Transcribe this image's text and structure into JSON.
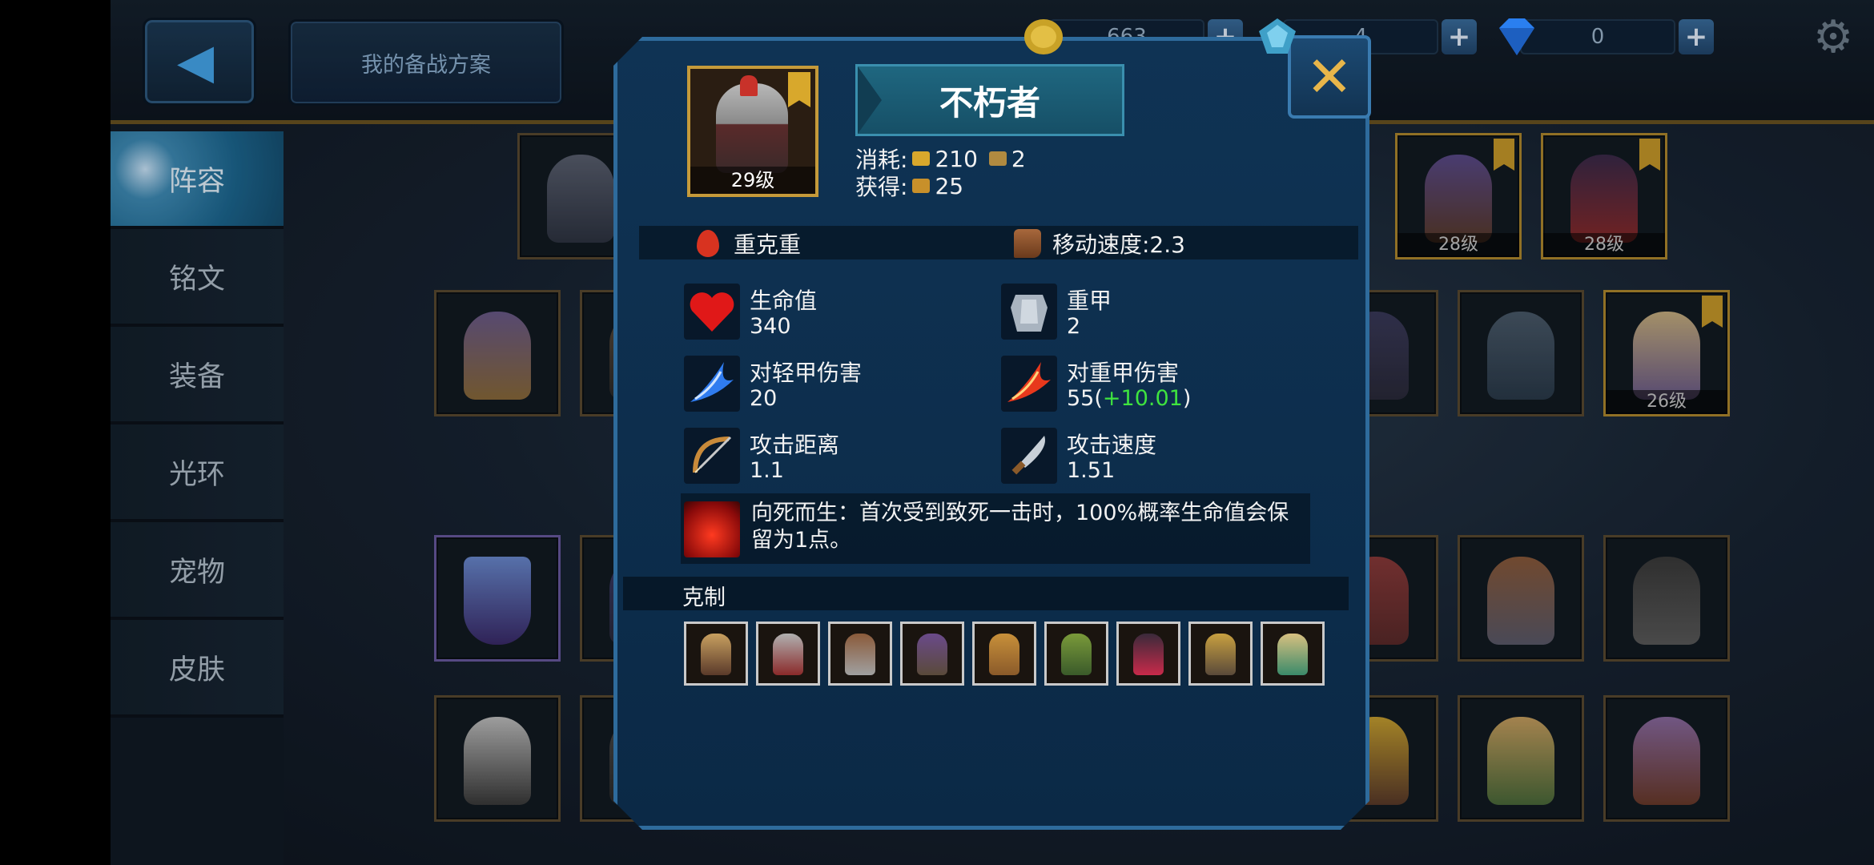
{
  "topbar": {
    "back_label": "‹",
    "plan_button": "我的备战方案",
    "currencies": [
      {
        "icon": "gold-coin-icon",
        "value": "663",
        "color": "#c9a227"
      },
      {
        "icon": "blue-gem-icon",
        "value": "4",
        "color": "#3fa0c8"
      },
      {
        "icon": "diamond-icon",
        "value": "0",
        "color": "#2a7ff0"
      }
    ],
    "plus": "+"
  },
  "sidebar": {
    "items": [
      {
        "label": "阵容",
        "active": true
      },
      {
        "label": "铭文"
      },
      {
        "label": "装备"
      },
      {
        "label": "光环"
      },
      {
        "label": "宠物"
      },
      {
        "label": "皮肤"
      }
    ]
  },
  "grid": {
    "levels": [
      "28级",
      "28级",
      "26级"
    ]
  },
  "popup": {
    "close": "✕",
    "portrait_level": "29级",
    "unit_name": "不朽者",
    "cost_label": "消耗:",
    "cost_gold": "210",
    "cost_pop": "2",
    "gain_label": "获得:",
    "gain_value": "25",
    "armor_class": "重克重",
    "move_speed": "移动速度:2.3",
    "stats": [
      {
        "label": "生命值",
        "value": "340",
        "icon": "heart-icon"
      },
      {
        "label": "重甲",
        "value": "2",
        "icon": "armor-icon"
      },
      {
        "label": "对轻甲伤害",
        "value": "20",
        "icon": "blue-slash-icon"
      },
      {
        "label": "对重甲伤害",
        "value": "55(",
        "bonus": "+10.01",
        "value_end": ")",
        "icon": "fire-slash-icon"
      },
      {
        "label": "攻击距离",
        "value": "1.1",
        "icon": "bow-icon"
      },
      {
        "label": "攻击速度",
        "value": "1.51",
        "icon": "dagger-icon"
      }
    ],
    "skill_text": "向死而生：首次受到致死一击时，100%概率生命值会保留为1点。",
    "counter_title": "克制",
    "counter_units": 9
  },
  "colors": {
    "accent_gold": "#c59a3a",
    "popup_bg": "#0f3354",
    "bonus_green": "#3fe33f"
  }
}
